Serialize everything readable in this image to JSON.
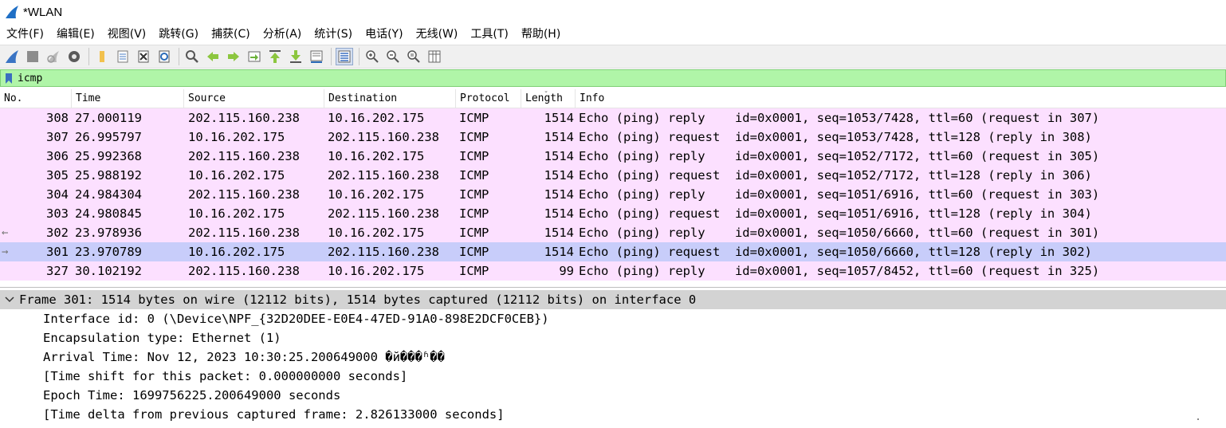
{
  "window": {
    "title": "*WLAN"
  },
  "menu": [
    "文件(F)",
    "编辑(E)",
    "视图(V)",
    "跳转(G)",
    "捕获(C)",
    "分析(A)",
    "统计(S)",
    "电话(Y)",
    "无线(W)",
    "工具(T)",
    "帮助(H)"
  ],
  "filter": {
    "value": "icmp"
  },
  "columns": {
    "no": "No.",
    "time": "Time",
    "source": "Source",
    "destination": "Destination",
    "protocol": "Protocol",
    "length": "Length",
    "info": "Info"
  },
  "packets": [
    {
      "no": "308",
      "time": "27.000119",
      "source": "202.115.160.238",
      "destination": "10.16.202.175",
      "protocol": "ICMP",
      "length": "1514",
      "info": "Echo (ping) reply    id=0x0001, seq=1053/7428, ttl=60 (request in 307)"
    },
    {
      "no": "307",
      "time": "26.995797",
      "source": "10.16.202.175",
      "destination": "202.115.160.238",
      "protocol": "ICMP",
      "length": "1514",
      "info": "Echo (ping) request  id=0x0001, seq=1053/7428, ttl=128 (reply in 308)"
    },
    {
      "no": "306",
      "time": "25.992368",
      "source": "202.115.160.238",
      "destination": "10.16.202.175",
      "protocol": "ICMP",
      "length": "1514",
      "info": "Echo (ping) reply    id=0x0001, seq=1052/7172, ttl=60 (request in 305)"
    },
    {
      "no": "305",
      "time": "25.988192",
      "source": "10.16.202.175",
      "destination": "202.115.160.238",
      "protocol": "ICMP",
      "length": "1514",
      "info": "Echo (ping) request  id=0x0001, seq=1052/7172, ttl=128 (reply in 306)"
    },
    {
      "no": "304",
      "time": "24.984304",
      "source": "202.115.160.238",
      "destination": "10.16.202.175",
      "protocol": "ICMP",
      "length": "1514",
      "info": "Echo (ping) reply    id=0x0001, seq=1051/6916, ttl=60 (request in 303)"
    },
    {
      "no": "303",
      "time": "24.980845",
      "source": "10.16.202.175",
      "destination": "202.115.160.238",
      "protocol": "ICMP",
      "length": "1514",
      "info": "Echo (ping) request  id=0x0001, seq=1051/6916, ttl=128 (reply in 304)"
    },
    {
      "no": "302",
      "time": "23.978936",
      "source": "202.115.160.238",
      "destination": "10.16.202.175",
      "protocol": "ICMP",
      "length": "1514",
      "info": "Echo (ping) reply    id=0x0001, seq=1050/6660, ttl=60 (request in 301)"
    },
    {
      "no": "301",
      "time": "23.970789",
      "source": "10.16.202.175",
      "destination": "202.115.160.238",
      "protocol": "ICMP",
      "length": "1514",
      "info": "Echo (ping) request  id=0x0001, seq=1050/6660, ttl=128 (reply in 302)"
    },
    {
      "no": "327",
      "time": "30.102192",
      "source": "202.115.160.238",
      "destination": "10.16.202.175",
      "protocol": "ICMP",
      "length": "99",
      "info": "Echo (ping) reply    id=0x0001, seq=1057/8452, ttl=60 (request in 325)"
    }
  ],
  "row_markers": {
    "302": "←",
    "301": "→"
  },
  "selected_packet": "301",
  "details": {
    "frame_summary": "Frame 301: 1514 bytes on wire (12112 bits), 1514 bytes captured (12112 bits) on interface 0",
    "lines": [
      "Interface id: 0 (\\Device\\NPF_{32D20DEE-E0E4-47ED-91A0-898E2DCF0CEB})",
      "Encapsulation type: Ethernet (1)",
      "Arrival Time: Nov 12, 2023 10:30:25.200649000 �й���ʱ��",
      "[Time shift for this packet: 0.000000000 seconds]",
      "Epoch Time: 1699756225.200649000 seconds",
      "[Time delta from previous captured frame: 2.826133000 seconds]"
    ]
  },
  "toolbar_icons": [
    "shark-fin-start-icon",
    "stop-capture-icon",
    "restart-capture-icon",
    "capture-options-icon",
    "open-file-icon",
    "save-file-icon",
    "close-file-icon",
    "reload-file-icon",
    "find-packet-icon",
    "go-back-icon",
    "go-forward-icon",
    "go-to-packet-icon",
    "first-packet-icon",
    "last-packet-icon",
    "autoscroll-icon",
    "colorize-icon",
    "zoom-in-icon",
    "zoom-out-icon",
    "zoom-normal-icon",
    "resize-columns-icon"
  ],
  "colors": {
    "row_bg": "#fce0ff",
    "selected_bg": "#c8cdfa",
    "filter_bg": "#b0f5a8",
    "frame_bg": "#d3d3d3"
  }
}
